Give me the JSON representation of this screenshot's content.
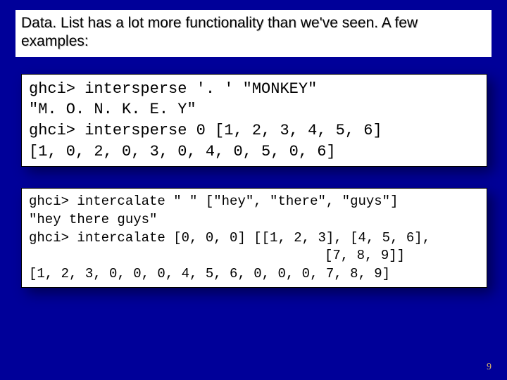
{
  "heading": "Data. List has a lot more functionality than we've seen.  A few examples:",
  "box1": {
    "l1": "ghci> intersperse '. ' \"MONKEY\"",
    "l2": "\"M. O. N. K. E. Y\"",
    "l3": "ghci> intersperse 0 [1, 2, 3, 4, 5, 6]",
    "l4": "[1, 0, 2, 0, 3, 0, 4, 0, 5, 0, 6]"
  },
  "box2": {
    "l1": "ghci> intercalate \" \" [\"hey\", \"there\", \"guys\"]",
    "l2": "\"hey there guys\"",
    "l3": "ghci> intercalate [0, 0, 0] [[1, 2, 3], [4, 5, 6],",
    "l4": "[7, 8, 9]]",
    "l5": "[1, 2, 3, 0, 0, 0, 4, 5, 6, 0, 0, 0, 7, 8, 9]"
  },
  "page": "9"
}
